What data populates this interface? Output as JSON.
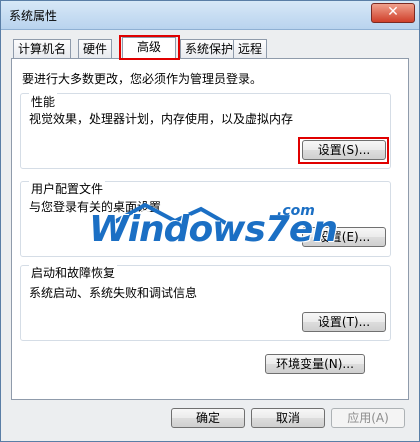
{
  "window": {
    "title": "系统属性",
    "close_glyph": "✕"
  },
  "tabs": [
    {
      "label": "计算机名"
    },
    {
      "label": "硬件"
    },
    {
      "label": "高级"
    },
    {
      "label": "系统保护"
    },
    {
      "label": "远程"
    }
  ],
  "admin_note": "要进行大多数更改，您必须作为管理员登录。",
  "performance": {
    "title": "性能",
    "description": "视觉效果，处理器计划，内存使用，以及虚拟内存",
    "button": "设置(S)..."
  },
  "user_profiles": {
    "title": "用户配置文件",
    "description": "与您登录有关的桌面设置",
    "button": "设置(E)..."
  },
  "startup_recovery": {
    "title": "启动和故障恢复",
    "description": "系统启动、系统失败和调试信息",
    "button": "设置(T)..."
  },
  "env_button": "环境变量(N)...",
  "footer": {
    "ok": "确定",
    "cancel": "取消",
    "apply": "应用(A)"
  },
  "watermark": {
    "text": "Windows7en",
    "sub": ".com"
  },
  "colors": {
    "highlight": "#e00000",
    "watermark": "#1b6fc4"
  }
}
